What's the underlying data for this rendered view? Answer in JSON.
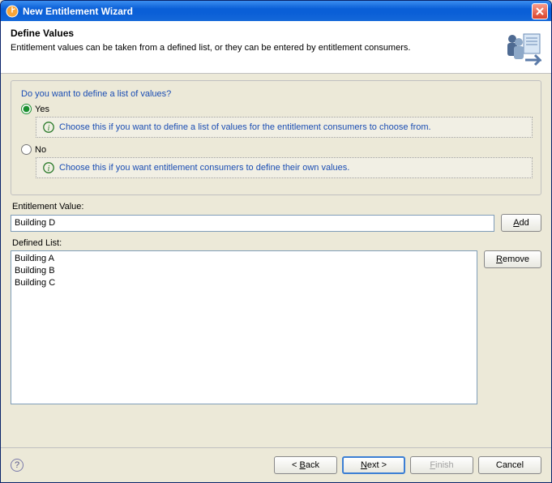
{
  "window": {
    "title": "New Entitlement Wizard"
  },
  "header": {
    "title": "Define Values",
    "description": "Entitlement values can be taken from a defined list, or they can be entered by entitlement consumers."
  },
  "group": {
    "question": "Do you want to define a list of values?",
    "yes_label": "Yes",
    "yes_info": "Choose this if you want to define a list of values for the entitlement consumers to choose from.",
    "no_label": "No",
    "no_info": "Choose this if you want entitlement consumers to define their own values.",
    "selected": "yes"
  },
  "entitlement": {
    "label": "Entitlement Value:",
    "value": "Building D",
    "add_label": "Add"
  },
  "defined_list": {
    "label": "Defined List:",
    "items": [
      "Building A",
      "Building B",
      "Building C"
    ],
    "remove_label": "Remove"
  },
  "buttons": {
    "back": "< Back",
    "next": "Next >",
    "finish": "Finish",
    "cancel": "Cancel"
  }
}
